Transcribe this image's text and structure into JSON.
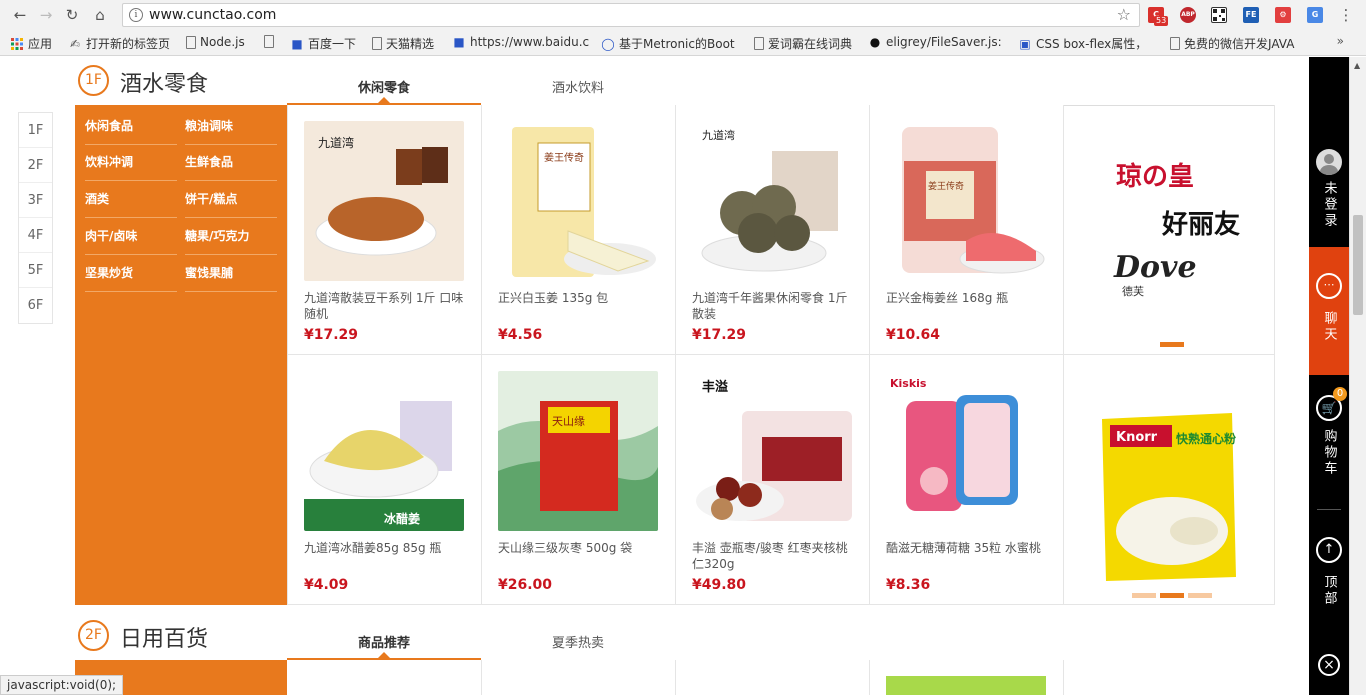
{
  "browser": {
    "url": "www.cunctao.com",
    "ext_badge": "53",
    "ext_labels": [
      "ABP",
      "FE"
    ],
    "bookmarks": [
      {
        "label": "应用",
        "icon": "apps-icon"
      },
      {
        "label": "打开新的标签页",
        "icon": "puzzle-icon"
      },
      {
        "label": "Node.js",
        "icon": "doc-icon"
      },
      {
        "label": "",
        "icon": "doc-icon"
      },
      {
        "label": "百度一下",
        "icon": "paw-icon"
      },
      {
        "label": "天猫精选",
        "icon": "doc-icon"
      },
      {
        "label": "https://www.baidu.c",
        "icon": "paw-icon"
      },
      {
        "label": "基于Metronic的Boot",
        "icon": "boot-icon"
      },
      {
        "label": "爱词霸在线词典",
        "icon": "doc-icon"
      },
      {
        "label": "eligrey/FileSaver.js:",
        "icon": "github-icon"
      },
      {
        "label": "CSS box-flex属性，",
        "icon": "css-icon"
      },
      {
        "label": "免费的微信开发JAVA",
        "icon": "doc-icon"
      }
    ],
    "more": "»"
  },
  "floor_nav": [
    "1F",
    "2F",
    "3F",
    "4F",
    "5F",
    "6F"
  ],
  "floor1": {
    "num": "1F",
    "title": "酒水零食",
    "tabs": [
      "休闲零食",
      "酒水饮料"
    ],
    "categories": [
      "休闲食品",
      "粮油调味",
      "饮料冲调",
      "生鲜食品",
      "酒类",
      "饼干/糕点",
      "肉干/卤味",
      "糖果/巧克力",
      "坚果炒货",
      "蜜饯果脯"
    ],
    "products": [
      {
        "name": "九道湾散装豆干系列 1斤 口味随机",
        "price": "¥17.29",
        "bg": "#f4e9dc",
        "fg": "#b8642a",
        "brand_text": "九道湾"
      },
      {
        "name": "正兴白玉姜 135g 包",
        "price": "¥4.56",
        "bg": "#f7e7a8",
        "fg": "#e8c23b",
        "brand_text": "姜王传奇"
      },
      {
        "name": "九道湾千年酱果休闲零食 1斤散装",
        "price": "¥17.29",
        "bg": "#ececec",
        "fg": "#6f6a4f",
        "brand_text": "九道湾"
      },
      {
        "name": "正兴金梅姜丝 168g 瓶",
        "price": "¥10.64",
        "bg": "#f5dcd6",
        "fg": "#d9685a",
        "brand_text": "姜王传奇"
      },
      {
        "name": "九道湾冰醋姜85g 85g 瓶",
        "price": "¥4.09",
        "bg": "#f3efd8",
        "fg": "#e7d46a",
        "brand_text": "冰醋姜"
      },
      {
        "name": "天山缘三级灰枣 500g 袋",
        "price": "¥26.00",
        "bg": "#e3efe1",
        "fg": "#d42a1f",
        "brand_text": "天山缘"
      },
      {
        "name": "丰溢 壶瓶枣/骏枣 红枣夹核桃仁320g",
        "price": "¥49.80",
        "bg": "#f3e2e2",
        "fg": "#9d1f26",
        "brand_text": "丰溢"
      },
      {
        "name": "酷滋无糖薄荷糖 35粒 水蜜桃",
        "price": "¥8.36",
        "bg": "#fbe3ea",
        "fg": "#e8567f",
        "brand_text": "Kiskis"
      }
    ],
    "brands": {
      "logos": [
        "琼の皇",
        "好丽友",
        "Dove",
        "德芙"
      ],
      "product_label": "Knorr",
      "product_text": "快熟通心粉"
    }
  },
  "floor2": {
    "num": "2F",
    "title": "日用百货",
    "tabs": [
      "商品推荐",
      "夏季热卖"
    ]
  },
  "status_text": "javascript:void(0);",
  "rightbar": {
    "login": "未登录",
    "chat": "聊天",
    "cart_count": "0",
    "cart": "购物车",
    "top": "顶部",
    "close": "×"
  },
  "colors": {
    "accent": "#e8791d",
    "price": "#c9151e",
    "chat_bg": "#e0420f"
  }
}
